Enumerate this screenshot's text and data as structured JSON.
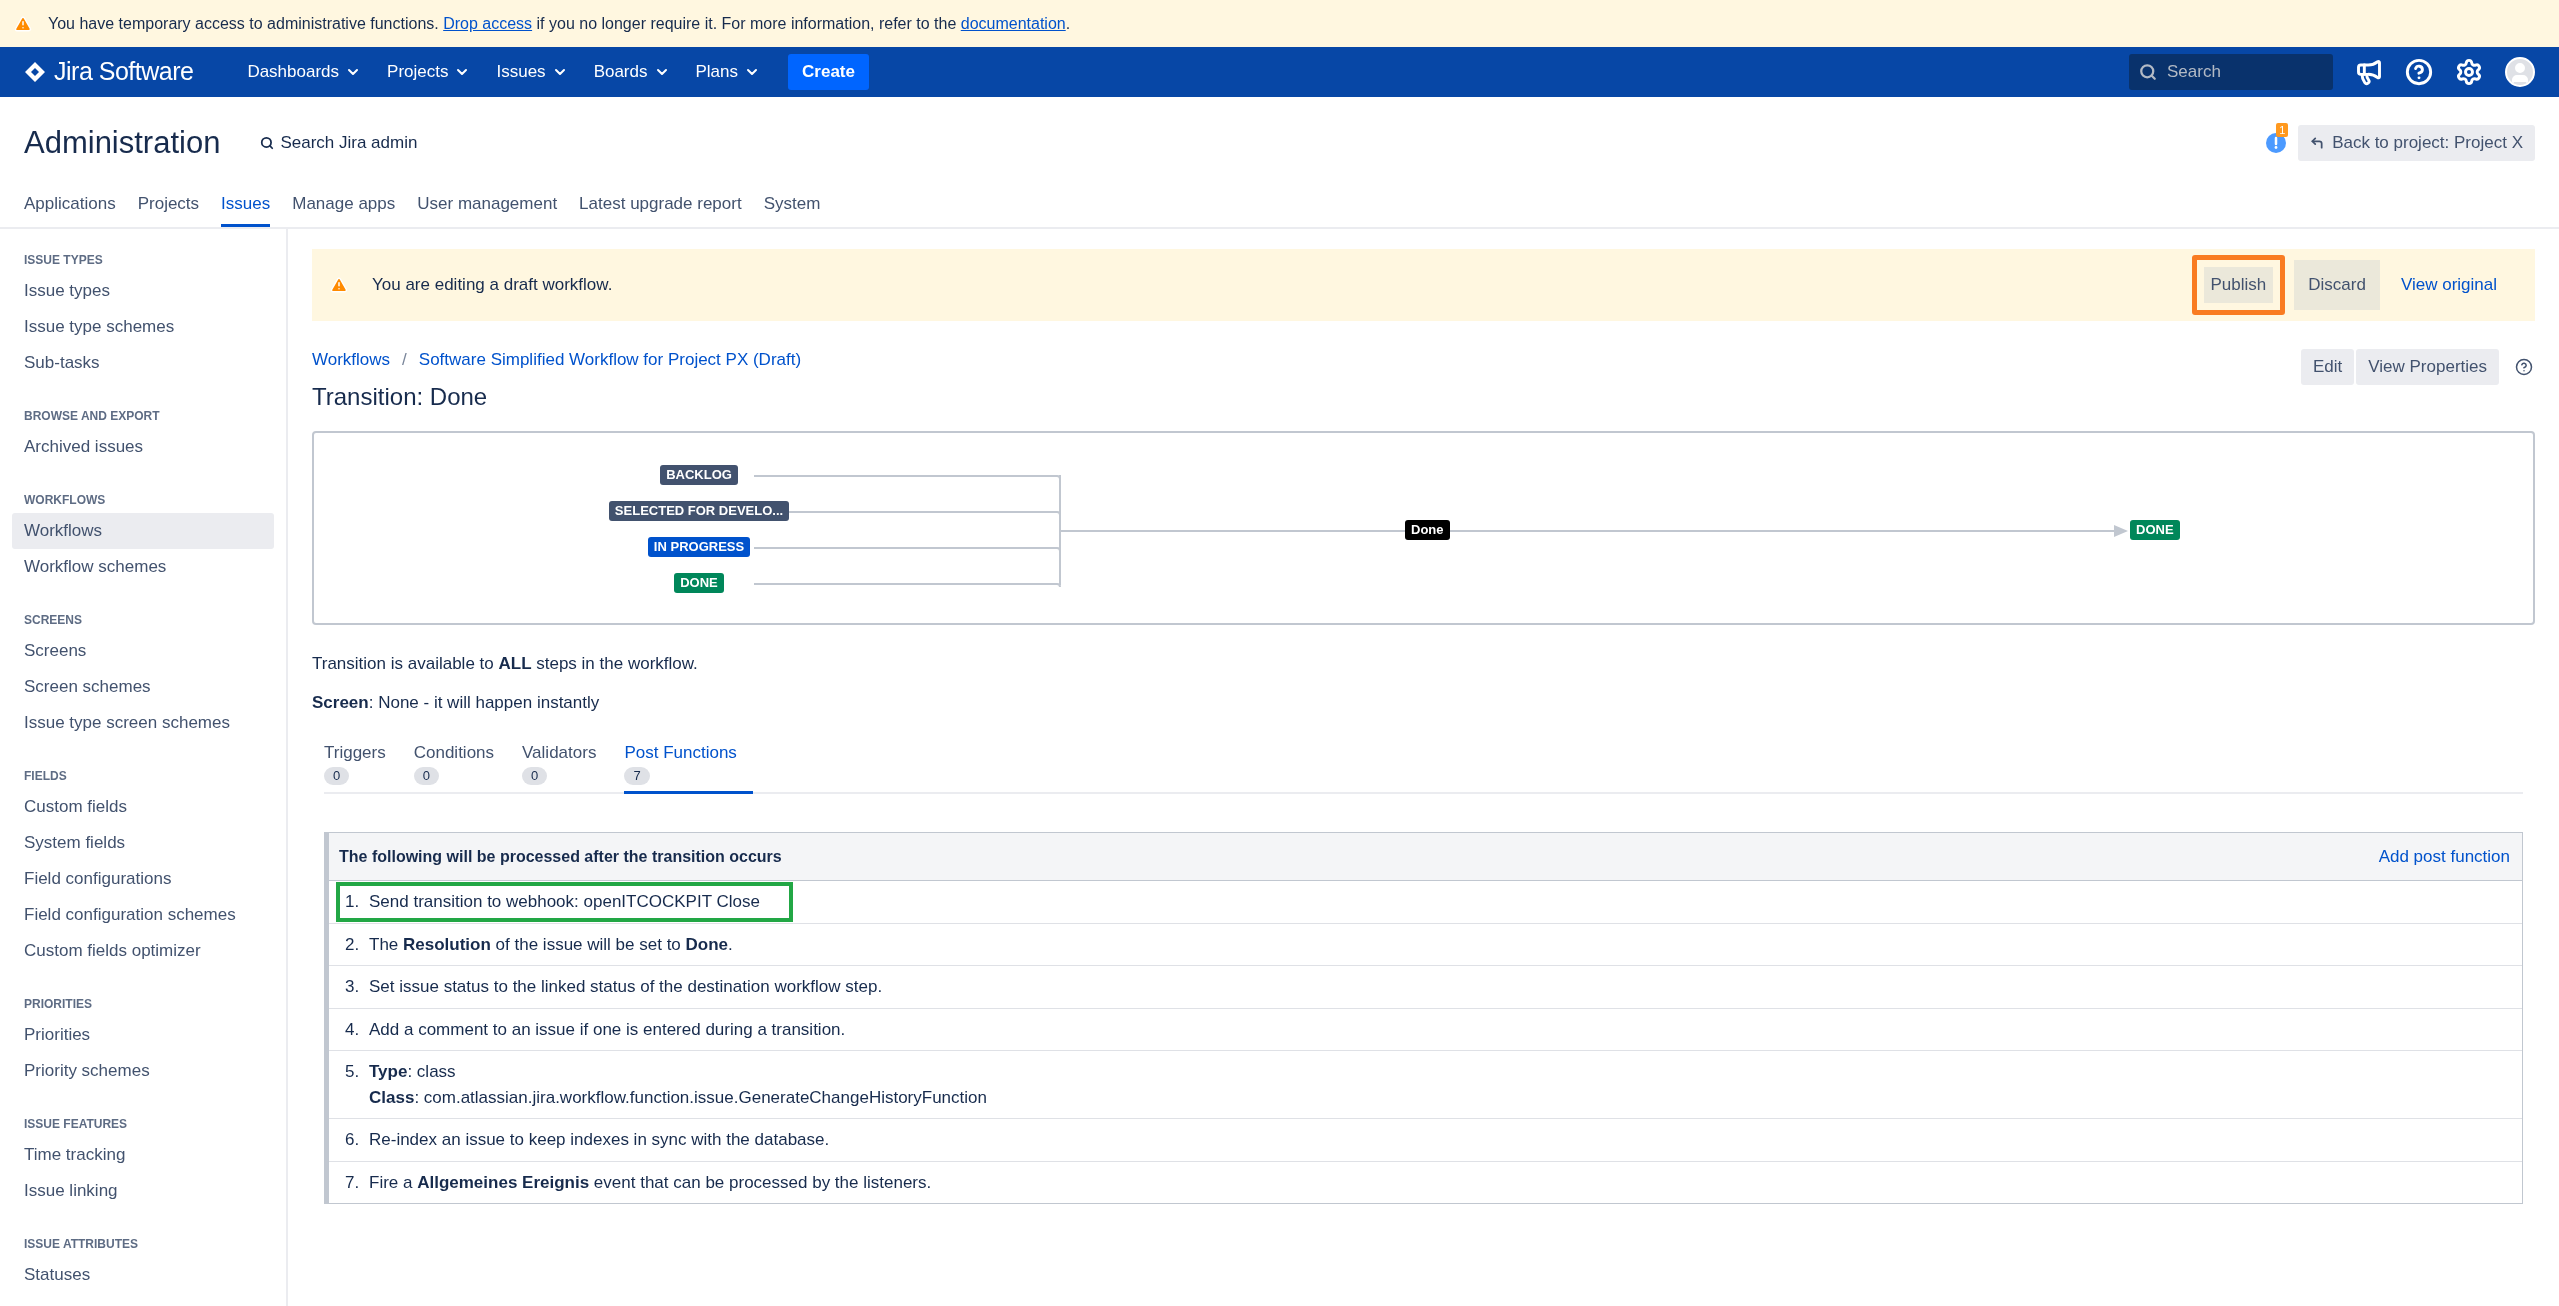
{
  "access_banner": {
    "parts": [
      {
        "kind": "text",
        "text": "You have temporary access to administrative functions."
      },
      {
        "kind": "link",
        "text": "Drop access"
      },
      {
        "kind": "text",
        "text": "if you no longer require it. For more information, refer to the"
      },
      {
        "kind": "link",
        "text": "documentation"
      },
      {
        "kind": "text",
        "text": "."
      }
    ]
  },
  "navbar": {
    "logo": "Jira Software",
    "menus": [
      "Dashboards",
      "Projects",
      "Issues",
      "Boards",
      "Plans"
    ],
    "create": "Create",
    "search_placeholder": "Search"
  },
  "admin_header": {
    "title": "Administration",
    "search": "Search Jira admin",
    "notification_count": "1",
    "back_button": "Back to project: Project X"
  },
  "admin_tabs": [
    {
      "label": "Applications",
      "selected": false
    },
    {
      "label": "Projects",
      "selected": false
    },
    {
      "label": "Issues",
      "selected": true
    },
    {
      "label": "Manage apps",
      "selected": false
    },
    {
      "label": "User management",
      "selected": false
    },
    {
      "label": "Latest upgrade report",
      "selected": false
    },
    {
      "label": "System",
      "selected": false
    }
  ],
  "sidebar": {
    "sections": [
      {
        "title": "ISSUE TYPES",
        "items": [
          {
            "label": "Issue types",
            "selected": false
          },
          {
            "label": "Issue type schemes",
            "selected": false
          },
          {
            "label": "Sub-tasks",
            "selected": false
          }
        ]
      },
      {
        "title": "BROWSE AND EXPORT",
        "items": [
          {
            "label": "Archived issues",
            "selected": false
          }
        ]
      },
      {
        "title": "WORKFLOWS",
        "items": [
          {
            "label": "Workflows",
            "selected": true
          },
          {
            "label": "Workflow schemes",
            "selected": false
          }
        ]
      },
      {
        "title": "SCREENS",
        "items": [
          {
            "label": "Screens",
            "selected": false
          },
          {
            "label": "Screen schemes",
            "selected": false
          },
          {
            "label": "Issue type screen schemes",
            "selected": false
          }
        ]
      },
      {
        "title": "FIELDS",
        "items": [
          {
            "label": "Custom fields",
            "selected": false
          },
          {
            "label": "System fields",
            "selected": false
          },
          {
            "label": "Field configurations",
            "selected": false
          },
          {
            "label": "Field configuration schemes",
            "selected": false
          },
          {
            "label": "Custom fields optimizer",
            "selected": false
          }
        ]
      },
      {
        "title": "PRIORITIES",
        "items": [
          {
            "label": "Priorities",
            "selected": false
          },
          {
            "label": "Priority schemes",
            "selected": false
          }
        ]
      },
      {
        "title": "ISSUE FEATURES",
        "items": [
          {
            "label": "Time tracking",
            "selected": false
          },
          {
            "label": "Issue linking",
            "selected": false
          }
        ]
      },
      {
        "title": "ISSUE ATTRIBUTES",
        "items": [
          {
            "label": "Statuses",
            "selected": false
          }
        ]
      }
    ]
  },
  "draft_banner": {
    "message": "You are editing a draft workflow.",
    "buttons": [
      {
        "label": "Publish",
        "highlighted": true
      },
      {
        "label": "Discard",
        "highlighted": false
      }
    ],
    "link": "View original"
  },
  "breadcrumbs": [
    "Workflows",
    "/",
    "Software Simplified Workflow for Project PX (Draft)"
  ],
  "title": "Transition: Done",
  "actions": [
    "Edit",
    "View Properties"
  ],
  "diagram": {
    "from_statuses": [
      {
        "label": "BACKLOG",
        "color": "#42526e"
      },
      {
        "label": "SELECTED FOR DEVELO...",
        "color": "#42526e"
      },
      {
        "label": "IN PROGRESS",
        "color": "#0052cc"
      },
      {
        "label": "DONE",
        "color": "#00875a"
      }
    ],
    "transition": "Done",
    "to_status": {
      "label": "DONE",
      "color": "#00875a"
    }
  },
  "availability": "Transition is available to **ALL** steps in the workflow.",
  "screen": "**Screen**: None - it will happen instantly",
  "tabs": [
    {
      "label": "Triggers",
      "count": "0",
      "selected": false
    },
    {
      "label": "Conditions",
      "count": "0",
      "selected": false
    },
    {
      "label": "Validators",
      "count": "0",
      "selected": false
    },
    {
      "label": "Post Functions",
      "count": "7",
      "selected": true
    }
  ],
  "post_functions": {
    "heading": "The following will be processed after the transition occurs",
    "add_link": "Add post function",
    "rows": [
      {
        "number": "1.",
        "lines": [
          "Send transition to webhook: openITCOCKPIT Close"
        ],
        "highlighted": true
      },
      {
        "number": "2.",
        "lines": [
          "The **Resolution** of the issue will be set to **Done**."
        ],
        "highlighted": false
      },
      {
        "number": "3.",
        "lines": [
          "Set issue status to the linked status of the destination workflow step."
        ],
        "highlighted": false
      },
      {
        "number": "4.",
        "lines": [
          "Add a comment to an issue if one is entered during a transition."
        ],
        "highlighted": false
      },
      {
        "number": "5.",
        "lines": [
          "**Type**: class",
          "**Class**: com.atlassian.jira.workflow.function.issue.GenerateChangeHistoryFunction"
        ],
        "highlighted": false
      },
      {
        "number": "6.",
        "lines": [
          "Re-index an issue to keep indexes in sync with the database."
        ],
        "highlighted": false
      },
      {
        "number": "7.",
        "lines": [
          "Fire a **Allgemeines Ereignis** event that can be processed by the listeners."
        ],
        "highlighted": false
      }
    ]
  }
}
